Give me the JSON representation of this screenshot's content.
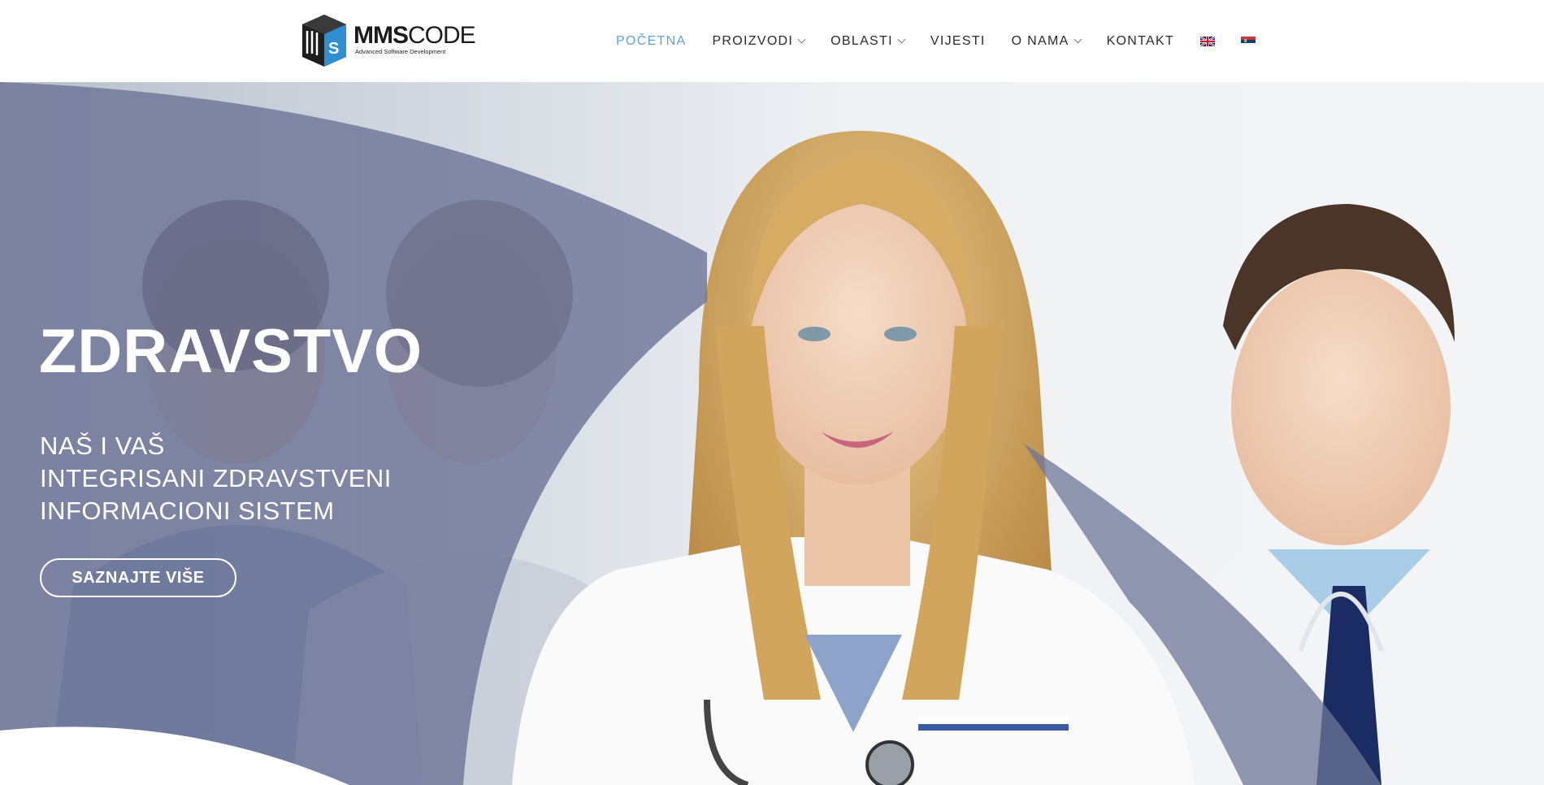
{
  "brand": {
    "name_bold": "MMS",
    "name_light": "CODE",
    "tagline": "Advanced Software Development",
    "accent_color": "#5fa2d6"
  },
  "nav": {
    "items": [
      {
        "label": "POČETNA",
        "active": true,
        "dropdown": false
      },
      {
        "label": "PROIZVODI",
        "active": false,
        "dropdown": true
      },
      {
        "label": "OBLASTI",
        "active": false,
        "dropdown": true
      },
      {
        "label": "VIJESTI",
        "active": false,
        "dropdown": false
      },
      {
        "label": "O NAMA",
        "active": false,
        "dropdown": true
      },
      {
        "label": "KONTAKT",
        "active": false,
        "dropdown": false
      }
    ],
    "languages": [
      {
        "icon": "uk-flag-icon"
      },
      {
        "icon": "serbian-flag-icon"
      }
    ]
  },
  "hero": {
    "title": "ZDRAVSTVO",
    "subtitle_lines": [
      "NAŠ I VAŠ",
      "INTEGRISANI ZDRAVSTVENI",
      "INFORMACIONI SISTEM"
    ],
    "button_label": "SAZNAJTE VIŠE",
    "overlay_color": "#6e7597"
  }
}
